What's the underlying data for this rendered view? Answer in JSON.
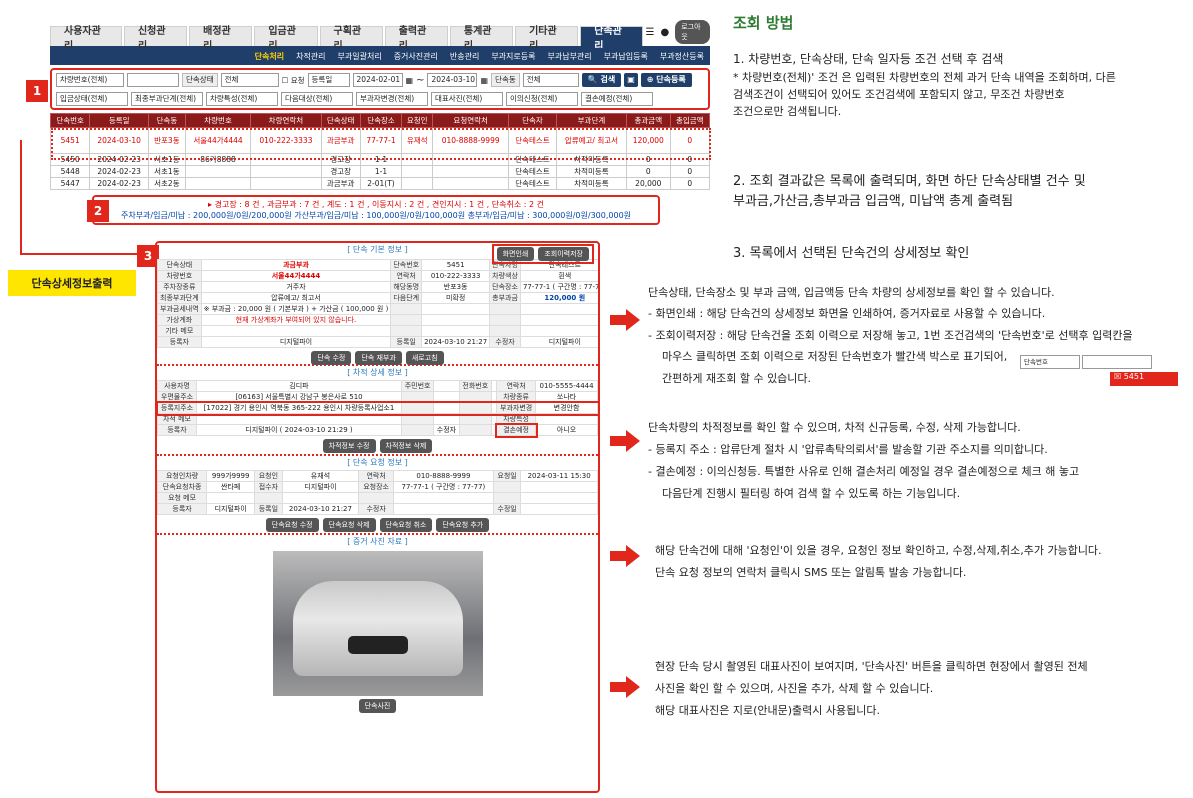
{
  "top_tabs": [
    "사용자관리",
    "신청관리",
    "배정관리",
    "입금관리",
    "구획관리",
    "출력관리",
    "통계관리",
    "기타관리",
    "단속관리"
  ],
  "logout": "로그아웃",
  "sub_tabs": [
    "단속처리",
    "차적관리",
    "부과일괄처리",
    "증거사진관리",
    "반송관리",
    "부과지로등록",
    "부과납부관리",
    "부과납입등록",
    "부과정산등록"
  ],
  "filter": {
    "row1": [
      "차량번호(전체)",
      "",
      "단속상태",
      "전체",
      "요청",
      "등록일",
      "2024-02-01",
      "~",
      "2024-03-10",
      "단속동",
      "전체"
    ],
    "search": "검색",
    "register": "단속등록",
    "row2": [
      "입금상태(전체)",
      "최종부과단계(전체)",
      "차량특성(전체)",
      "다음대상(전체)",
      "부과자변경(전체)",
      "대표사진(전체)",
      "이의신청(전체)",
      "결손예정(전체)"
    ]
  },
  "badges": [
    "1",
    "2",
    "3"
  ],
  "table": {
    "headers": [
      "단속번호",
      "등록일",
      "단속동",
      "차량번호",
      "차량연락처",
      "단속상태",
      "단속장소",
      "요청인",
      "요청연락처",
      "단속자",
      "부과단계",
      "총과금액",
      "총입금액"
    ],
    "rows": [
      [
        "5451",
        "2024-03-10",
        "반포3동",
        "서울44가4444",
        "010-222-3333",
        "과금부과",
        "77-77-1",
        "유재석",
        "010-8888-9999",
        "단속테스트",
        "압류예고/ 최고서",
        "120,000",
        "0"
      ],
      [
        "5450",
        "2024-02-23",
        "서초1동",
        "86가8888",
        "",
        "경고장",
        "1-1",
        "",
        "",
        "단속테스트",
        "차적미등록",
        "0",
        "0"
      ],
      [
        "5448",
        "2024-02-23",
        "서초1동",
        "",
        "",
        "경고장",
        "1-1",
        "",
        "",
        "단속테스트",
        "차적미등록",
        "0",
        "0"
      ],
      [
        "5447",
        "2024-02-23",
        "서초2동",
        "",
        "",
        "과금부과",
        "2-01(T)",
        "",
        "",
        "단속테스트",
        "차적미등록",
        "20,000",
        "0"
      ]
    ]
  },
  "summary": {
    "line1": "▸ 경고장 : 8 건 , 과금부과 : 7 건 , 계도 : 1 건 , 이동지시 : 2 건 , 견인지시 : 1 건 , 단속취소 : 2 건",
    "line2": "주차부과/입금/미납 : 200,000원/0원/200,000원  가산부과/입금/미납 : 100,000원/0원/100,000원  총부과/입금/미납 : 300,000원/0원/300,000원"
  },
  "side_label": "단속상세정보출력",
  "detail": {
    "basic_title": "[ 단속 기본 정보 ]",
    "print_btn": "화면인쇄",
    "save_btn": "조회이력저장",
    "basic_rows": [
      [
        "단속상태",
        "과금부과",
        "단속번호",
        "5451",
        "단속자명",
        "단속테스트",
        "단속일자",
        "2024-03-11 15:40"
      ],
      [
        "차량번호",
        "서울44가4444",
        "연락처",
        "010-222-3333",
        "차량색상",
        "흰색",
        "차량종류",
        "쏘나타"
      ],
      [
        "주차장종류",
        "거주자",
        "해당동명",
        "반포3동",
        "단속장소",
        "77-77-1 ( 구간명 : 77-77)",
        "",
        ""
      ],
      [
        "최종부과단계",
        "압류예고/ 최고서",
        "다음단계",
        "미확정",
        "총부과금",
        "120,000 원",
        "총입금액",
        "120,000 원"
      ],
      [
        "부과금세내역",
        "※ 부과금 : 20,000 원 ( 기본부과 ) + 가산금 ( 100,000 원 )",
        "",
        "",
        "",
        "",
        "단속연번",
        "2024 - 27"
      ],
      [
        "가상계좌",
        "현재 가상계좌가 부여되어 있지 않습니다.",
        "",
        "",
        "",
        "",
        "",
        ""
      ],
      [
        "기타 메모",
        "",
        "",
        "",
        "",
        "",
        "",
        ""
      ],
      [
        "등록자",
        "디지털파이",
        "등록일",
        "2024-03-10 21:27",
        "수정자",
        "디지털파이",
        "수정일",
        "2024-03-10 21:29"
      ]
    ],
    "basic_btns": [
      "단속 수정",
      "단속 재부과",
      "새로고침"
    ],
    "car_title": "[ 차적 상세 정보 ]",
    "car_rows": [
      [
        "사용자명",
        "김디파",
        "주민번호",
        "",
        "전화번호",
        "",
        "연락처",
        "010-5555-4444"
      ],
      [
        "우편물주소",
        "[06163] 서울특별시 강남구 봉은사로 510",
        "",
        "",
        "",
        "",
        "차량종류",
        "쏘나타"
      ],
      [
        "등록지주소",
        "[17022] 경기 용인시 역북동 365-222 용인시 차량등록사업소1",
        "",
        "",
        "",
        "",
        "부과자변경",
        "변경안함"
      ],
      [
        "차적 메모",
        "",
        "",
        "",
        "",
        "",
        "차량특성",
        ""
      ],
      [
        "등록자",
        "디지털파이 ( 2024-03-10 21:29 )",
        "",
        "수정자",
        "",
        "",
        "결손예정",
        "아니오"
      ]
    ],
    "car_btns": [
      "차적정보 수정",
      "차적정보 삭제"
    ],
    "req_title": "[ 단속 요청 정보 ]",
    "req_rows": [
      [
        "요청인차량",
        "999가9999",
        "요청인",
        "유재석",
        "연락처",
        "010-8888-9999",
        "요청일",
        "2024-03-11 15:30"
      ],
      [
        "단속요청차종",
        "싼타페",
        "접수자",
        "디지털파이",
        "요청장소",
        "77-77-1 ( 구간명 : 77-77)",
        "",
        ""
      ],
      [
        "요청 메모",
        "",
        "",
        "",
        "",
        "",
        "",
        ""
      ],
      [
        "등록자",
        "디지털파이",
        "등록일",
        "2024-03-10 21:27",
        "수정자",
        "",
        "수정일",
        ""
      ]
    ],
    "req_btns": [
      "단속요청 수정",
      "단속요청 삭제",
      "단속요청 취소",
      "단속요청 추가"
    ],
    "photo_title": "[ 증거 사진 자료 ]",
    "photo_btn": "단속사진"
  },
  "right": {
    "heading": "조회 방법",
    "p1": [
      "1. 차량번호, 단속상태, 단속 일자등  조건 선택 후 검색",
      "* 차량번호(전체)' 조건 은 입력된 차량번호의 전체 과거  단속 내역을 조회하며, 다른",
      "검색조건이 선택되어 있어도 조건검색에 포함되지 않고, 무조건 차량번호",
      "조건으로만 검색됩니다."
    ],
    "p2": [
      "2. 조회 결과값은 목록에 출력되며, 화면 하단 단속상태별 건수 및",
      "부과금,가산금,총부과금 입금액, 미납액 총계 출력됨"
    ],
    "p3": [
      "3. 목록에서 선택된 단속건의 상세정보 확인"
    ],
    "b1": [
      "단속상태, 단속장소 및 부과 금액, 입금액등 단속 차량의 상세정보를 확인 할 수 있습니다.",
      "- 화면인쇄 : 해당 단속건의 상세정보 화면을 인쇄하여, 증거자료로 사용할 수 있습니다.",
      "- 조회이력저장 : 해당 단속건을 조회 이력으로 저장해 놓고, 1번 조건검색의 '단속번호'로 선택후 입력칸을",
      "마우스 클릭하면 조회 이력으로 저장된 단속번호가 빨간색 박스로 표기되어,",
      "간편하게 재조회 할 수 있습니다."
    ],
    "mini_sel": "단속번호",
    "mini_val": "5451",
    "b2": [
      "단속차량의 차적정보를 확인 할 수 있으며, 차적 신규등록, 수정, 삭제 가능합니다.",
      "- 등록지 주소 : 압류단계 절차 시 '압류촉탁의뢰서'를 발송할 기관 주소지를 의미합니다.",
      "- 결손예정 : 이의신청등. 특별한 사유로 인해 결손처리 예정일 경우 결손예정으로 체크 해 놓고",
      "다음단계 진행시 필터링 하여 검색 할 수 있도록 하는 기능입니다."
    ],
    "b3": [
      "해당 단속건에 대해 '요청인'이 있을 경우, 요청인 정보 확인하고, 수정,삭제,취소,추가 가능합니다.",
      "단속 요청 정보의 연락처 클릭시 SMS 또는 알림톡 발송 가능합니다."
    ],
    "b4": [
      "현장 단속 당시 촬영된 대표사진이 보여지며, '단속사진' 버튼을 클릭하면 현장에서 촬영된 전체",
      "사진을 확인 할 수 있으며, 사진을 추가, 삭제 할 수 있습니다.",
      "해당 대표사진은 지로(안내문)출력시 사용됩니다."
    ]
  },
  "colors": {
    "red": "#e1261c",
    "navy": "#1f3f6a",
    "heading": "#2e7d32",
    "table_head": "#8b1a1a"
  }
}
